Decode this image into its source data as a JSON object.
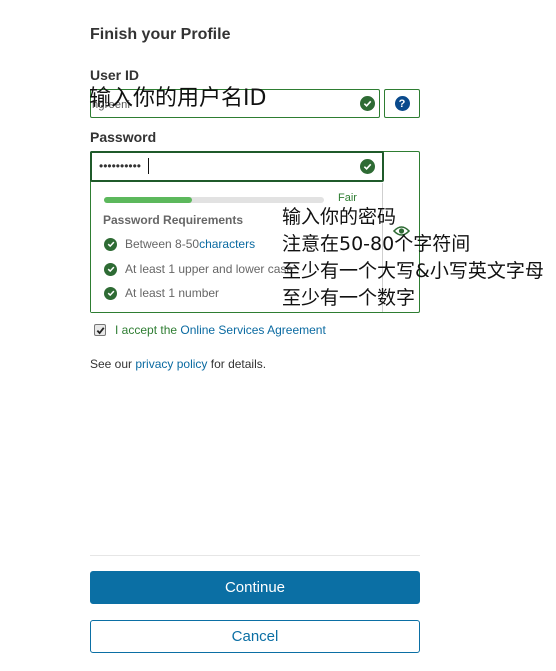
{
  "form": {
    "title": "Finish your Profile",
    "userid_label": "User ID",
    "userid_value": "hgreeni",
    "userid_overlay": "输入你的用户名ID",
    "password_label": "Password",
    "password_value": "••••••••••",
    "strength": {
      "label": "Fair",
      "fraction": 0.4
    },
    "requirements_title": "Password Requirements",
    "requirements": [
      {
        "text": "Between 8-50 ",
        "link": "characters"
      },
      {
        "text": "At least 1 upper and lower case",
        "link": ""
      },
      {
        "text": "At least 1 number",
        "link": ""
      }
    ],
    "notes": [
      "输入你的密码",
      "注意在50-80个字符间",
      "至少有一个大写&小写英文字母",
      "至少有一个数字"
    ],
    "accept_prefix": "I accept the ",
    "accept_link": "Online Services Agreement",
    "policy_prefix": "See our ",
    "policy_link": "privacy policy",
    "policy_suffix": " for details.",
    "continue_label": "Continue",
    "cancel_label": "Cancel"
  },
  "colors": {
    "valid_green": "#2e7d32",
    "primary_blue": "#0b6fa4",
    "help_blue": "#0a4a8c"
  },
  "icons": [
    "check-circle-icon",
    "help-icon",
    "eye-icon",
    "checkbox-check-icon"
  ]
}
